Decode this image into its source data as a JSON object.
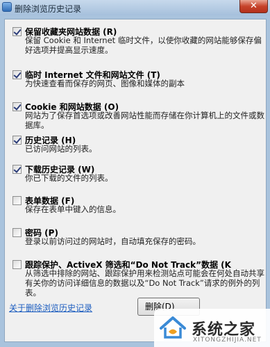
{
  "window": {
    "title": "删除浏览历史记录",
    "close_glyph": "✕"
  },
  "options": [
    {
      "title": "保留收藏夹网站数据 (R)",
      "desc": "保留 Cookie 和 Internet 临时文件，以使你收藏的网站能够保存偏好选项并提高显示速度。",
      "checked": true
    },
    {
      "title": "临时 Internet 文件和网站文件 (T)",
      "desc": "为快速查看而保存的网页、图像和媒体的副本",
      "checked": true
    },
    {
      "title": "Cookie 和网站数据 (O)",
      "desc": "网站为了保存首选项或改善网站性能而存储在你计算机上的文件或数据库。",
      "checked": true
    },
    {
      "title": "历史记录 (H)",
      "desc": "已访问网站的列表。",
      "checked": true
    },
    {
      "title": "下载历史记录 (W)",
      "desc": "你已下载的文件的列表。",
      "checked": true
    },
    {
      "title": "表单数据 (F)",
      "desc": "保存在表单中键入的信息。",
      "checked": false
    },
    {
      "title": "密码 (P)",
      "desc": "登录以前访问过的网站时，自动填充保存的密码。",
      "checked": false
    },
    {
      "title": "跟踪保护、ActiveX 筛选和“Do Not Track”数据 (K",
      "desc": "从筛选中排除的网站、跟踪保护用来检测站点可能会在何处自动共享有关你的访问详细信息的数据以及“Do Not Track”请求的例外的列表。",
      "checked": false
    }
  ],
  "footer": {
    "link": "关于删除浏览历史记录",
    "delete_button": "删除(D)"
  },
  "watermark": {
    "text": "系统之家",
    "sub": "XITONGZHIJIA.NET"
  }
}
